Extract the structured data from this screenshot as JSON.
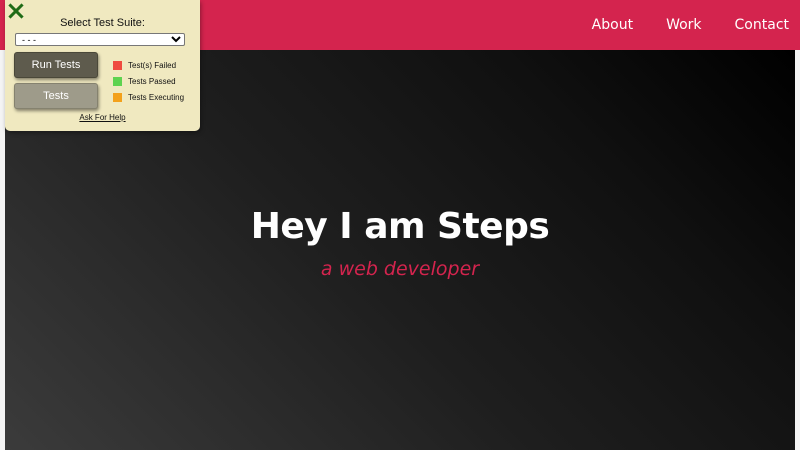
{
  "nav": {
    "links": [
      "About",
      "Work",
      "Contact"
    ]
  },
  "hero": {
    "title": "Hey I am Steps",
    "subtitle": "a web developer"
  },
  "test_panel": {
    "title": "Select Test Suite:",
    "select_value": "- - -",
    "run_button": "Run Tests",
    "tests_button": "Tests",
    "legend": [
      {
        "label": "Test(s) Failed",
        "color": "#ef4b3f"
      },
      {
        "label": "Tests Passed",
        "color": "#5ed34f"
      },
      {
        "label": "Tests Executing",
        "color": "#f3a11b"
      }
    ],
    "help_link": "Ask For Help",
    "close_icon": "close-x-icon"
  },
  "colors": {
    "brand": "#d4244e",
    "panel_bg": "#f0e9c0"
  }
}
